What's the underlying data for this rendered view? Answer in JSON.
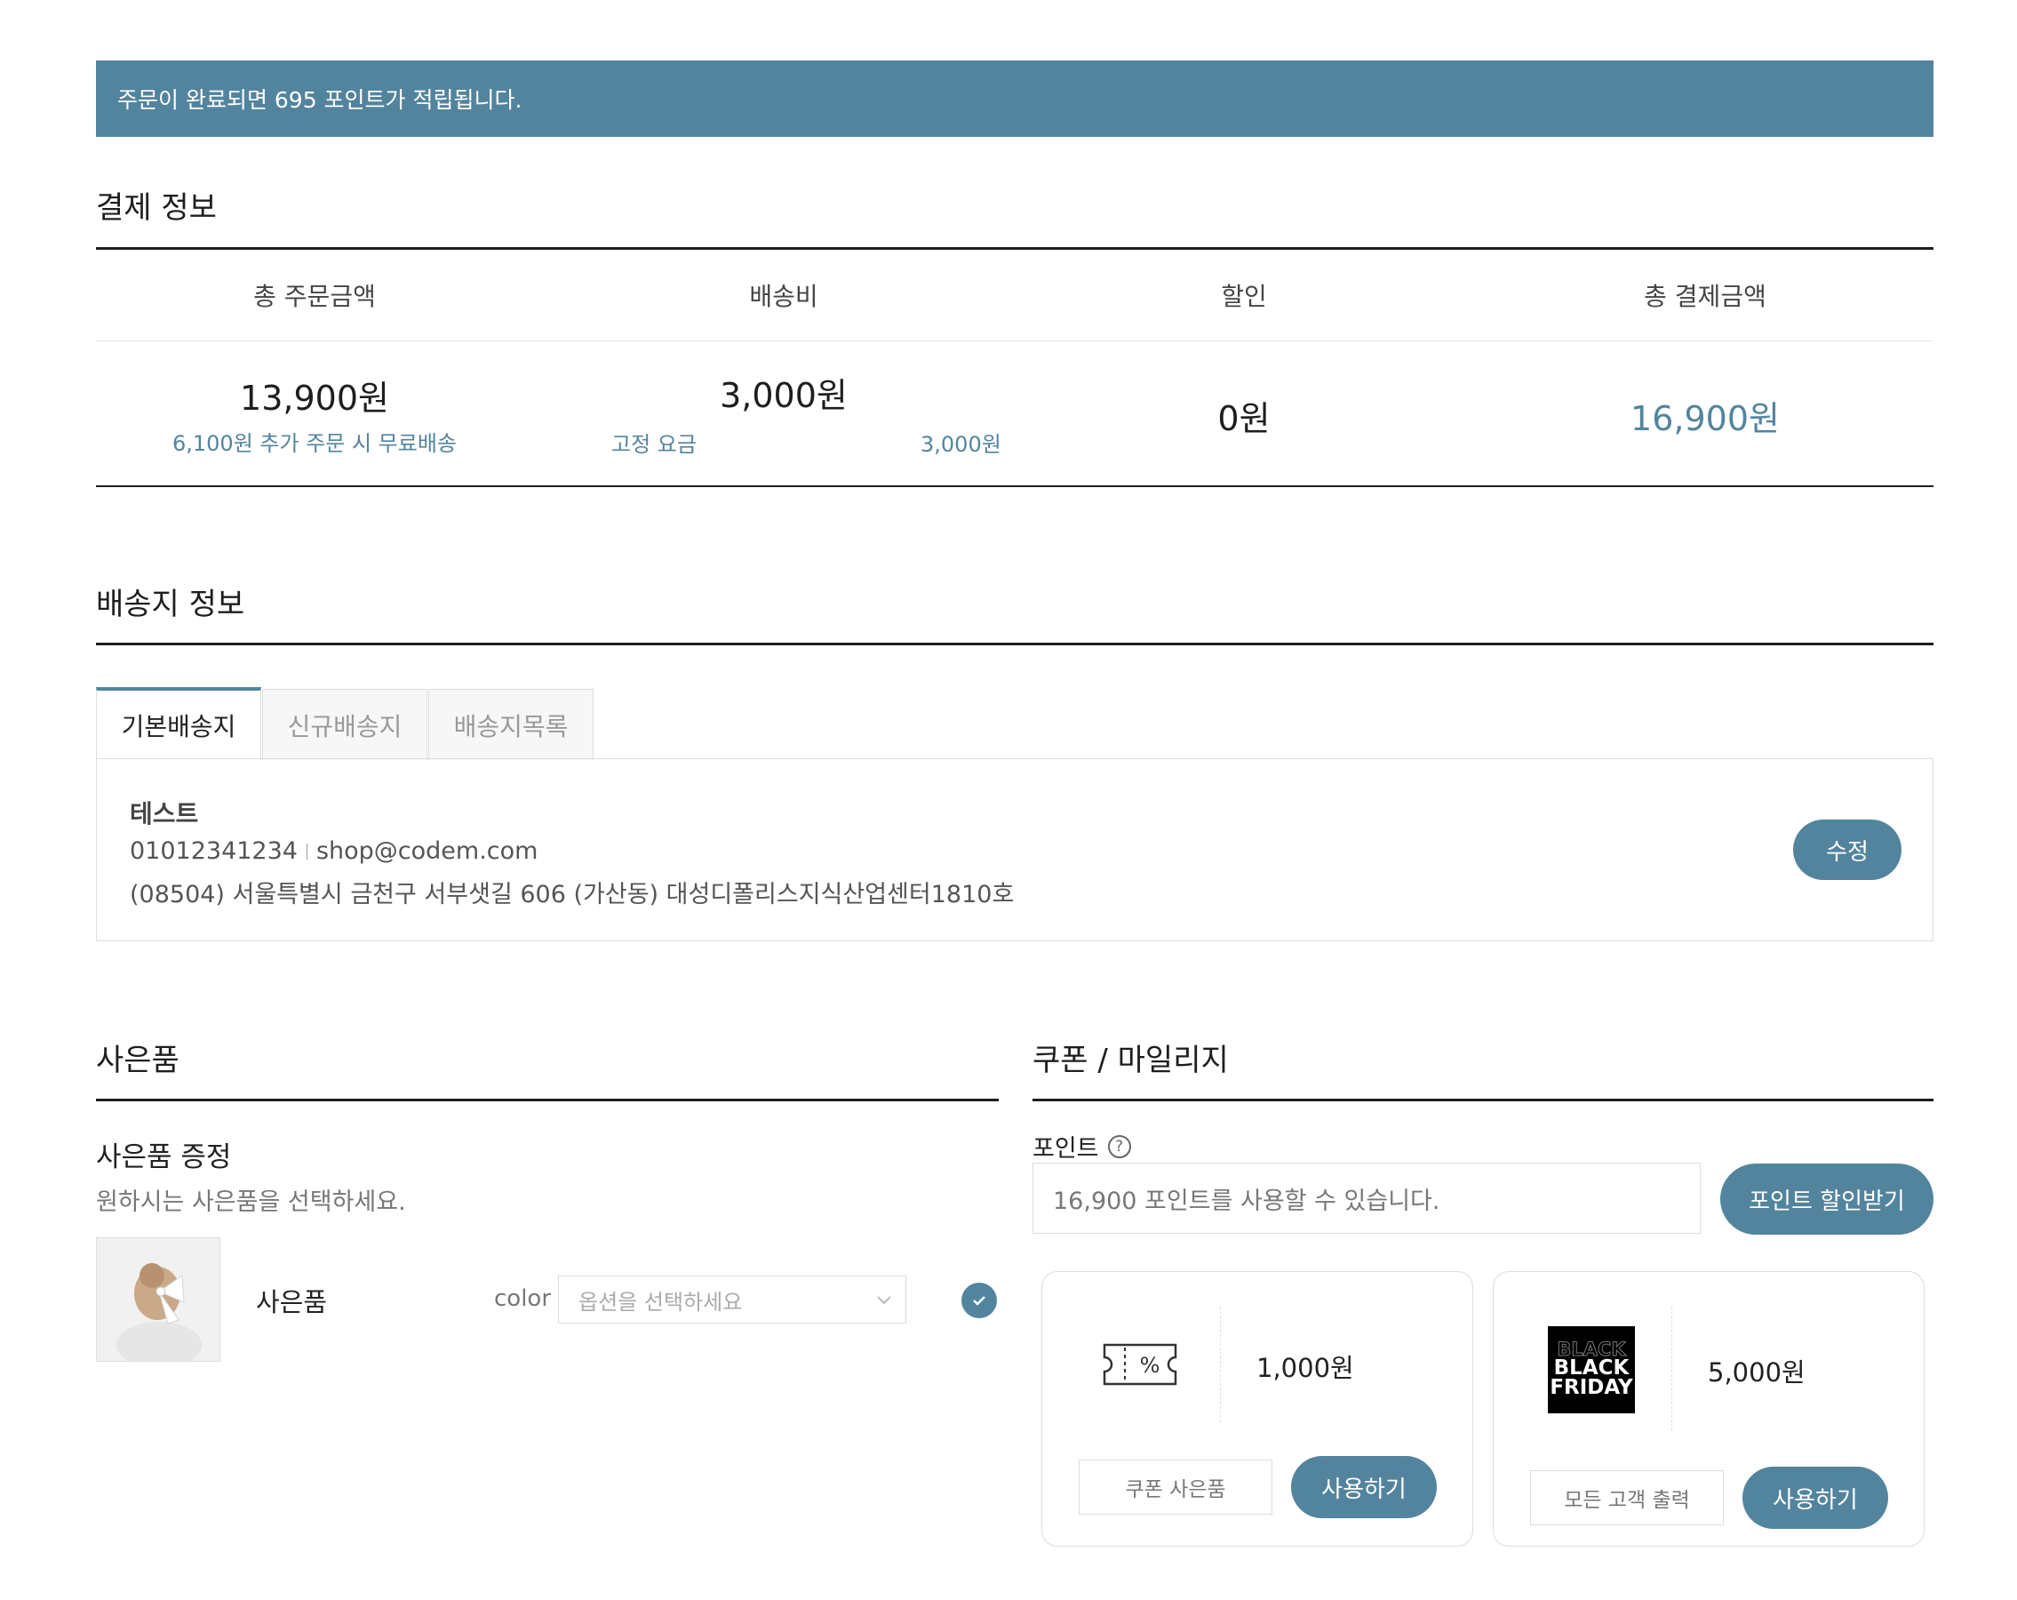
{
  "banner": {
    "text": "주문이 완료되면 695 포인트가 적립됩니다."
  },
  "payment": {
    "title": "결제 정보",
    "headers": [
      "총 주문금액",
      "배송비",
      "할인",
      "총 결제금액"
    ],
    "total_order": "13,900원",
    "free_shipping_note": "6,100원 추가 주문 시 무료배송",
    "shipping_fee": "3,000원",
    "shipping_type": "고정 요금",
    "shipping_type_amount": "3,000원",
    "discount": "0원",
    "grand_total": "16,900원"
  },
  "shipping": {
    "title": "배송지 정보",
    "tabs": [
      "기본배송지",
      "신규배송지",
      "배송지목록"
    ],
    "name": "테스트",
    "phone": "01012341234",
    "email": "shop@codem.com",
    "address": "(08504) 서울특별시 금천구 서부샛길 606 (가산동) 대성디폴리스지식산업센터1810호",
    "edit_button": "수정"
  },
  "gift": {
    "title": "사은품",
    "subtitle": "사은품 증정",
    "description": "원하시는 사은품을 선택하세요.",
    "item_name": "사은품",
    "option_label": "color",
    "option_placeholder": "옵션을 선택하세요"
  },
  "coupon": {
    "title": "쿠폰 / 마일리지",
    "points_label": "포인트",
    "points_placeholder": "16,900 포인트를 사용할 수 있습니다.",
    "points_button": "포인트 할인받기",
    "cards": [
      {
        "amount": "1,000원",
        "name": "쿠폰 사은품",
        "button": "사용하기",
        "icon": "ticket-percent-icon"
      },
      {
        "amount": "5,000원",
        "name": "모든 고객 출력",
        "button": "사용하기",
        "image_text": [
          "BLACK",
          "BLACK",
          "FRIDAY"
        ]
      }
    ]
  },
  "colors": {
    "accent": "#53849e"
  }
}
